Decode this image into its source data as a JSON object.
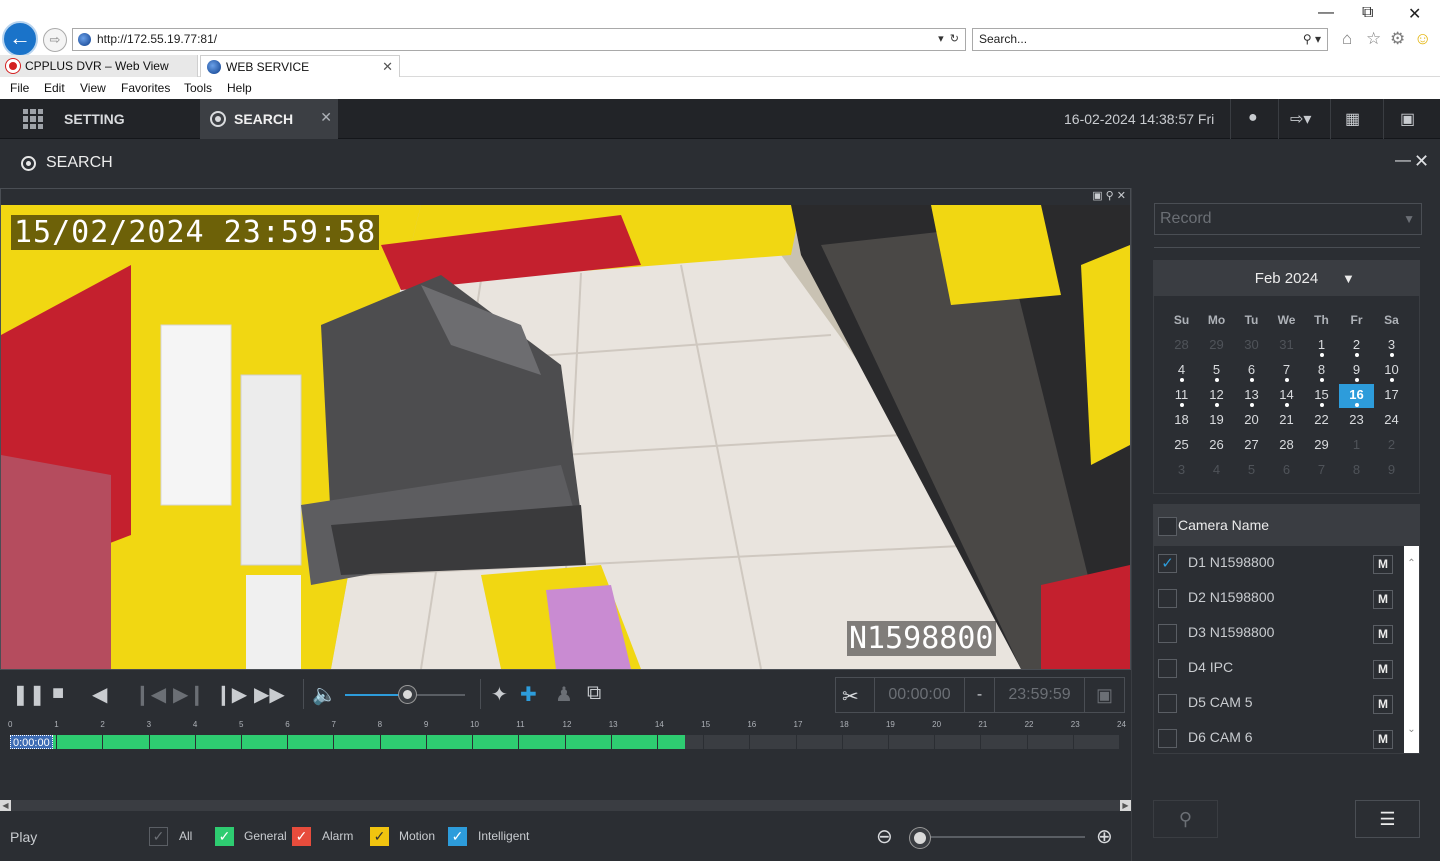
{
  "browser": {
    "url": "http://172.55.19.77:81/",
    "search_placeholder": "Search...",
    "tabs": [
      {
        "label": "CPPLUS DVR – Web View"
      },
      {
        "label": "WEB SERVICE"
      }
    ],
    "menu": [
      "File",
      "Edit",
      "View",
      "Favorites",
      "Tools",
      "Help"
    ]
  },
  "app_header": {
    "setting_label": "SETTING",
    "search_tab_label": "SEARCH",
    "datetime": "16-02-2024 14:38:57 Fri"
  },
  "page": {
    "title": "SEARCH"
  },
  "video": {
    "osd_timestamp": "15/02/2024 23:59:58",
    "osd_camera": "N1598800"
  },
  "playback": {
    "volume_level": 0.52,
    "clip_start": "00:00:00",
    "clip_separator": "-",
    "clip_end": "23:59:59"
  },
  "timeline": {
    "hour_ticks": [
      "0",
      "1",
      "2",
      "3",
      "4",
      "5",
      "6",
      "7",
      "8",
      "9",
      "10",
      "11",
      "12",
      "13",
      "14",
      "15",
      "16",
      "17",
      "18",
      "19",
      "20",
      "21",
      "22",
      "23",
      "24"
    ],
    "recorded_until_hour": 14.6,
    "current_time": "0:00:00"
  },
  "legend": {
    "play_label": "Play",
    "items": [
      {
        "label": "All",
        "color": "#2b2e33"
      },
      {
        "label": "General",
        "color": "#2ecc71"
      },
      {
        "label": "Alarm",
        "color": "#e74c3c"
      },
      {
        "label": "Motion",
        "color": "#f1c40f"
      },
      {
        "label": "Intelligent",
        "color": "#2d9cdb"
      }
    ],
    "zoom_level": 0.0
  },
  "right_panel": {
    "record_type": "Record",
    "calendar": {
      "month_label": "Feb 2024",
      "weekdays": [
        "Su",
        "Mo",
        "Tu",
        "We",
        "Th",
        "Fr",
        "Sa"
      ],
      "selected_day": "16",
      "weeks": [
        [
          "28",
          "29",
          "30",
          "31",
          "1",
          "2",
          "3"
        ],
        [
          "4",
          "5",
          "6",
          "7",
          "8",
          "9",
          "10"
        ],
        [
          "11",
          "12",
          "13",
          "14",
          "15",
          "16",
          "17"
        ],
        [
          "18",
          "19",
          "20",
          "21",
          "22",
          "23",
          "24"
        ],
        [
          "25",
          "26",
          "27",
          "28",
          "29",
          "1",
          "2"
        ],
        [
          "3",
          "4",
          "5",
          "6",
          "7",
          "8",
          "9"
        ]
      ],
      "recorded_days": [
        "1",
        "2",
        "3",
        "4",
        "5",
        "6",
        "7",
        "8",
        "9",
        "10",
        "11",
        "12",
        "13",
        "14",
        "15",
        "16"
      ]
    },
    "camera_list": {
      "header": "Camera Name",
      "cameras": [
        {
          "label": "D1 N1598800",
          "checked": true,
          "mode": "M"
        },
        {
          "label": "D2 N1598800",
          "checked": false,
          "mode": "M"
        },
        {
          "label": "D3 N1598800",
          "checked": false,
          "mode": "M"
        },
        {
          "label": "D4 IPC",
          "checked": false,
          "mode": "M"
        },
        {
          "label": "D5 CAM 5",
          "checked": false,
          "mode": "M"
        },
        {
          "label": "D6 CAM 6",
          "checked": false,
          "mode": "M"
        }
      ]
    }
  },
  "colors": {
    "accent": "#2d9cdb",
    "record_bar": "#2ecc71",
    "panel_bg": "#2b2e33",
    "header_bg": "#222428"
  }
}
